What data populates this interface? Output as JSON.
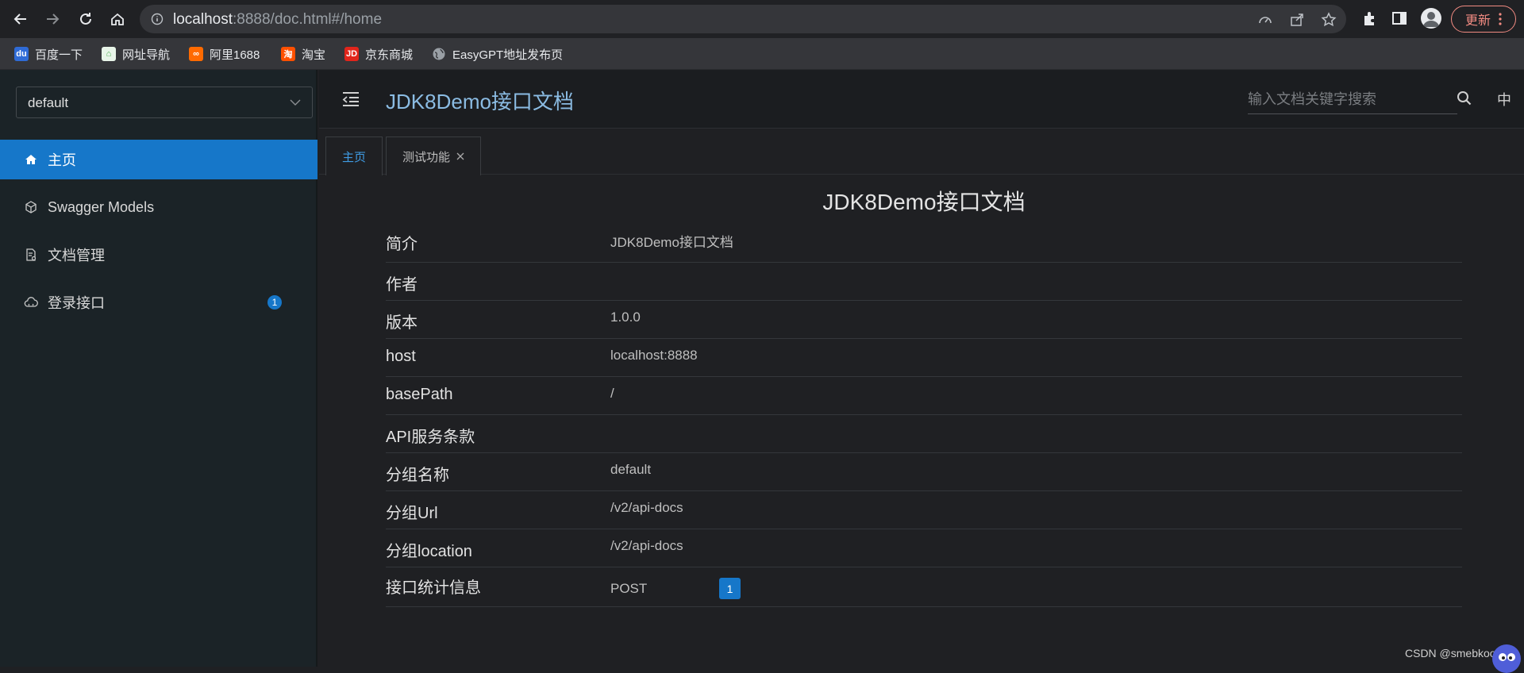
{
  "browser": {
    "url_host": "localhost",
    "url_rest": ":8888/doc.html#/home",
    "update_label": "更新"
  },
  "bookmarks": [
    {
      "label": "百度一下",
      "icon": "baidu-icon",
      "color": "#2f6bd6"
    },
    {
      "label": "网址导航",
      "icon": "nav-icon",
      "color": "#4caf50"
    },
    {
      "label": "阿里1688",
      "icon": "ali1688-icon",
      "color": "#ff6a00"
    },
    {
      "label": "淘宝",
      "icon": "taobao-icon",
      "color": "#ff5000"
    },
    {
      "label": "京东商城",
      "icon": "jd-icon",
      "color": "#e1251b"
    },
    {
      "label": "EasyGPT地址发布页",
      "icon": "globe-icon",
      "color": "#9aa0a6"
    }
  ],
  "sidebar": {
    "group": "default",
    "items": [
      {
        "label": "主页",
        "icon": "home-icon",
        "active": true
      },
      {
        "label": "Swagger Models",
        "icon": "models-icon",
        "active": false
      },
      {
        "label": "文档管理",
        "icon": "doc-manage-icon",
        "active": false
      },
      {
        "label": "登录接口",
        "icon": "cloud-api-icon",
        "active": false,
        "badge": "1"
      }
    ]
  },
  "header": {
    "title": "JDK8Demo接口文档",
    "search_placeholder": "输入文档关键字搜索",
    "lang": "中"
  },
  "tabs": [
    {
      "label": "主页",
      "active": true
    },
    {
      "label": "测试功能",
      "active": false
    }
  ],
  "doc": {
    "title": "JDK8Demo接口文档",
    "rows": [
      {
        "key": "简介",
        "value": "JDK8Demo接口文档"
      },
      {
        "key": "作者",
        "value": ""
      },
      {
        "key": "版本",
        "value": "1.0.0"
      },
      {
        "key": "host",
        "value": "localhost:8888"
      },
      {
        "key": "basePath",
        "value": "/"
      },
      {
        "key": "API服务条款",
        "value": ""
      },
      {
        "key": "分组名称",
        "value": "default"
      },
      {
        "key": "分组Url",
        "value": "/v2/api-docs"
      },
      {
        "key": "分组location",
        "value": "/v2/api-docs"
      },
      {
        "key": "接口统计信息",
        "value": "POST",
        "count": "1"
      }
    ]
  },
  "watermark": "CSDN @smebkoon",
  "colors": {
    "accent": "#1677c9",
    "header_title": "#8bbce3",
    "active_tab": "#3f9be3",
    "update": "#f28b82"
  }
}
